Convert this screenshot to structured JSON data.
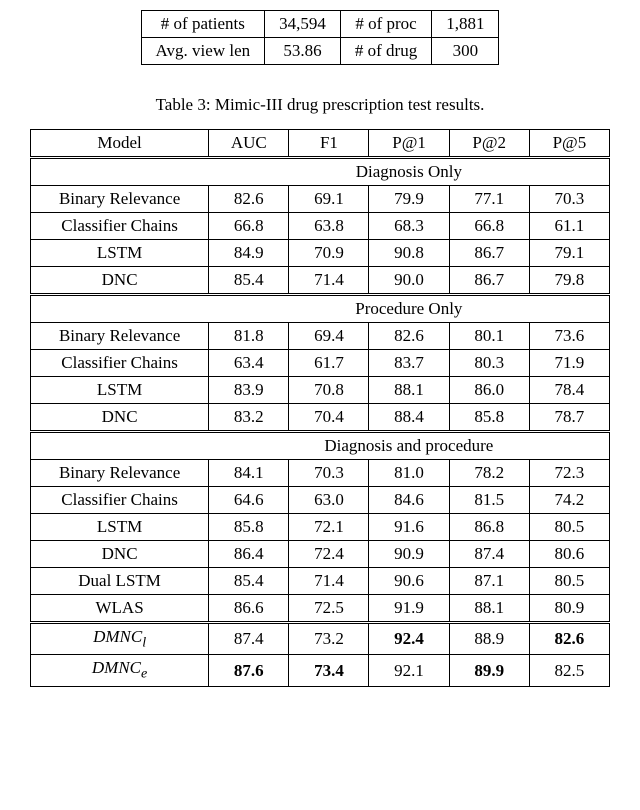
{
  "top_table": {
    "r1c1": "# of patients",
    "r1c2": "34,594",
    "r1c3": "# of proc",
    "r1c4": "1,881",
    "r2c1": "Avg. view len",
    "r2c2": "53.86",
    "r2c3": "# of drug",
    "r2c4": "300"
  },
  "caption": "Table 3: Mimic-III drug prescription test results.",
  "headers": {
    "c0": "Model",
    "c1": "AUC",
    "c2": "F1",
    "c3": "P@1",
    "c4": "P@2",
    "c5": "P@5"
  },
  "sections": {
    "s1": "Diagnosis Only",
    "s2": "Procedure Only",
    "s3": "Diagnosis and procedure"
  },
  "rows": {
    "diag": {
      "br": {
        "m": "Binary Relevance",
        "auc": "82.6",
        "f1": "69.1",
        "p1": "79.9",
        "p2": "77.1",
        "p5": "70.3"
      },
      "cc": {
        "m": "Classifier Chains",
        "auc": "66.8",
        "f1": "63.8",
        "p1": "68.3",
        "p2": "66.8",
        "p5": "61.1"
      },
      "lstm": {
        "m": "LSTM",
        "auc": "84.9",
        "f1": "70.9",
        "p1": "90.8",
        "p2": "86.7",
        "p5": "79.1"
      },
      "dnc": {
        "m": "DNC",
        "auc": "85.4",
        "f1": "71.4",
        "p1": "90.0",
        "p2": "86.7",
        "p5": "79.8"
      }
    },
    "proc": {
      "br": {
        "m": "Binary Relevance",
        "auc": "81.8",
        "f1": "69.4",
        "p1": "82.6",
        "p2": "80.1",
        "p5": "73.6"
      },
      "cc": {
        "m": "Classifier Chains",
        "auc": "63.4",
        "f1": "61.7",
        "p1": "83.7",
        "p2": "80.3",
        "p5": "71.9"
      },
      "lstm": {
        "m": "LSTM",
        "auc": "83.9",
        "f1": "70.8",
        "p1": "88.1",
        "p2": "86.0",
        "p5": "78.4"
      },
      "dnc": {
        "m": "DNC",
        "auc": "83.2",
        "f1": "70.4",
        "p1": "88.4",
        "p2": "85.8",
        "p5": "78.7"
      }
    },
    "both": {
      "br": {
        "m": "Binary Relevance",
        "auc": "84.1",
        "f1": "70.3",
        "p1": "81.0",
        "p2": "78.2",
        "p5": "72.3"
      },
      "cc": {
        "m": "Classifier Chains",
        "auc": "64.6",
        "f1": "63.0",
        "p1": "84.6",
        "p2": "81.5",
        "p5": "74.2"
      },
      "lstm": {
        "m": "LSTM",
        "auc": "85.8",
        "f1": "72.1",
        "p1": "91.6",
        "p2": "86.8",
        "p5": "80.5"
      },
      "dnc": {
        "m": "DNC",
        "auc": "86.4",
        "f1": "72.4",
        "p1": "90.9",
        "p2": "87.4",
        "p5": "80.6"
      },
      "dual": {
        "m": "Dual LSTM",
        "auc": "85.4",
        "f1": "71.4",
        "p1": "90.6",
        "p2": "87.1",
        "p5": "80.5"
      },
      "wlas": {
        "m": "WLAS",
        "auc": "86.6",
        "f1": "72.5",
        "p1": "91.9",
        "p2": "88.1",
        "p5": "80.9"
      }
    },
    "dmnc": {
      "l": {
        "pre": "DMNC",
        "sub": "l",
        "auc": "87.4",
        "f1": "73.2",
        "p1": "92.4",
        "p2": "88.9",
        "p5": "82.6"
      },
      "e": {
        "pre": "DMNC",
        "sub": "e",
        "auc": "87.6",
        "f1": "73.4",
        "p1": "92.1",
        "p2": "89.9",
        "p5": "82.5"
      }
    }
  }
}
